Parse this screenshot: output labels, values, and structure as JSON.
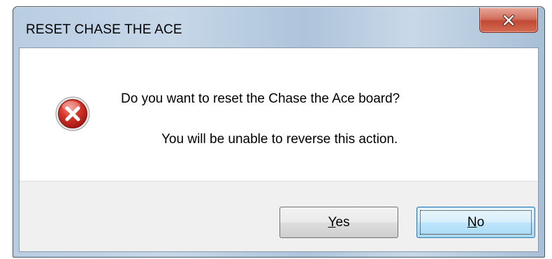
{
  "window": {
    "title": "RESET CHASE THE ACE",
    "close_icon": "close-icon"
  },
  "message": {
    "icon": "error-icon",
    "primary": "Do you want to reset the Chase the Ace board?",
    "secondary": "You will be unable to reverse this action."
  },
  "buttons": {
    "yes": {
      "accel": "Y",
      "rest": "es",
      "label": "Yes"
    },
    "no": {
      "accel": "N",
      "rest": "o",
      "label": "No",
      "focused": true
    }
  },
  "colors": {
    "error_red": "#c8201a",
    "close_red": "#c04a36",
    "title_gradient": "#b9cde2",
    "focus_blue": "#3c7fb1"
  }
}
